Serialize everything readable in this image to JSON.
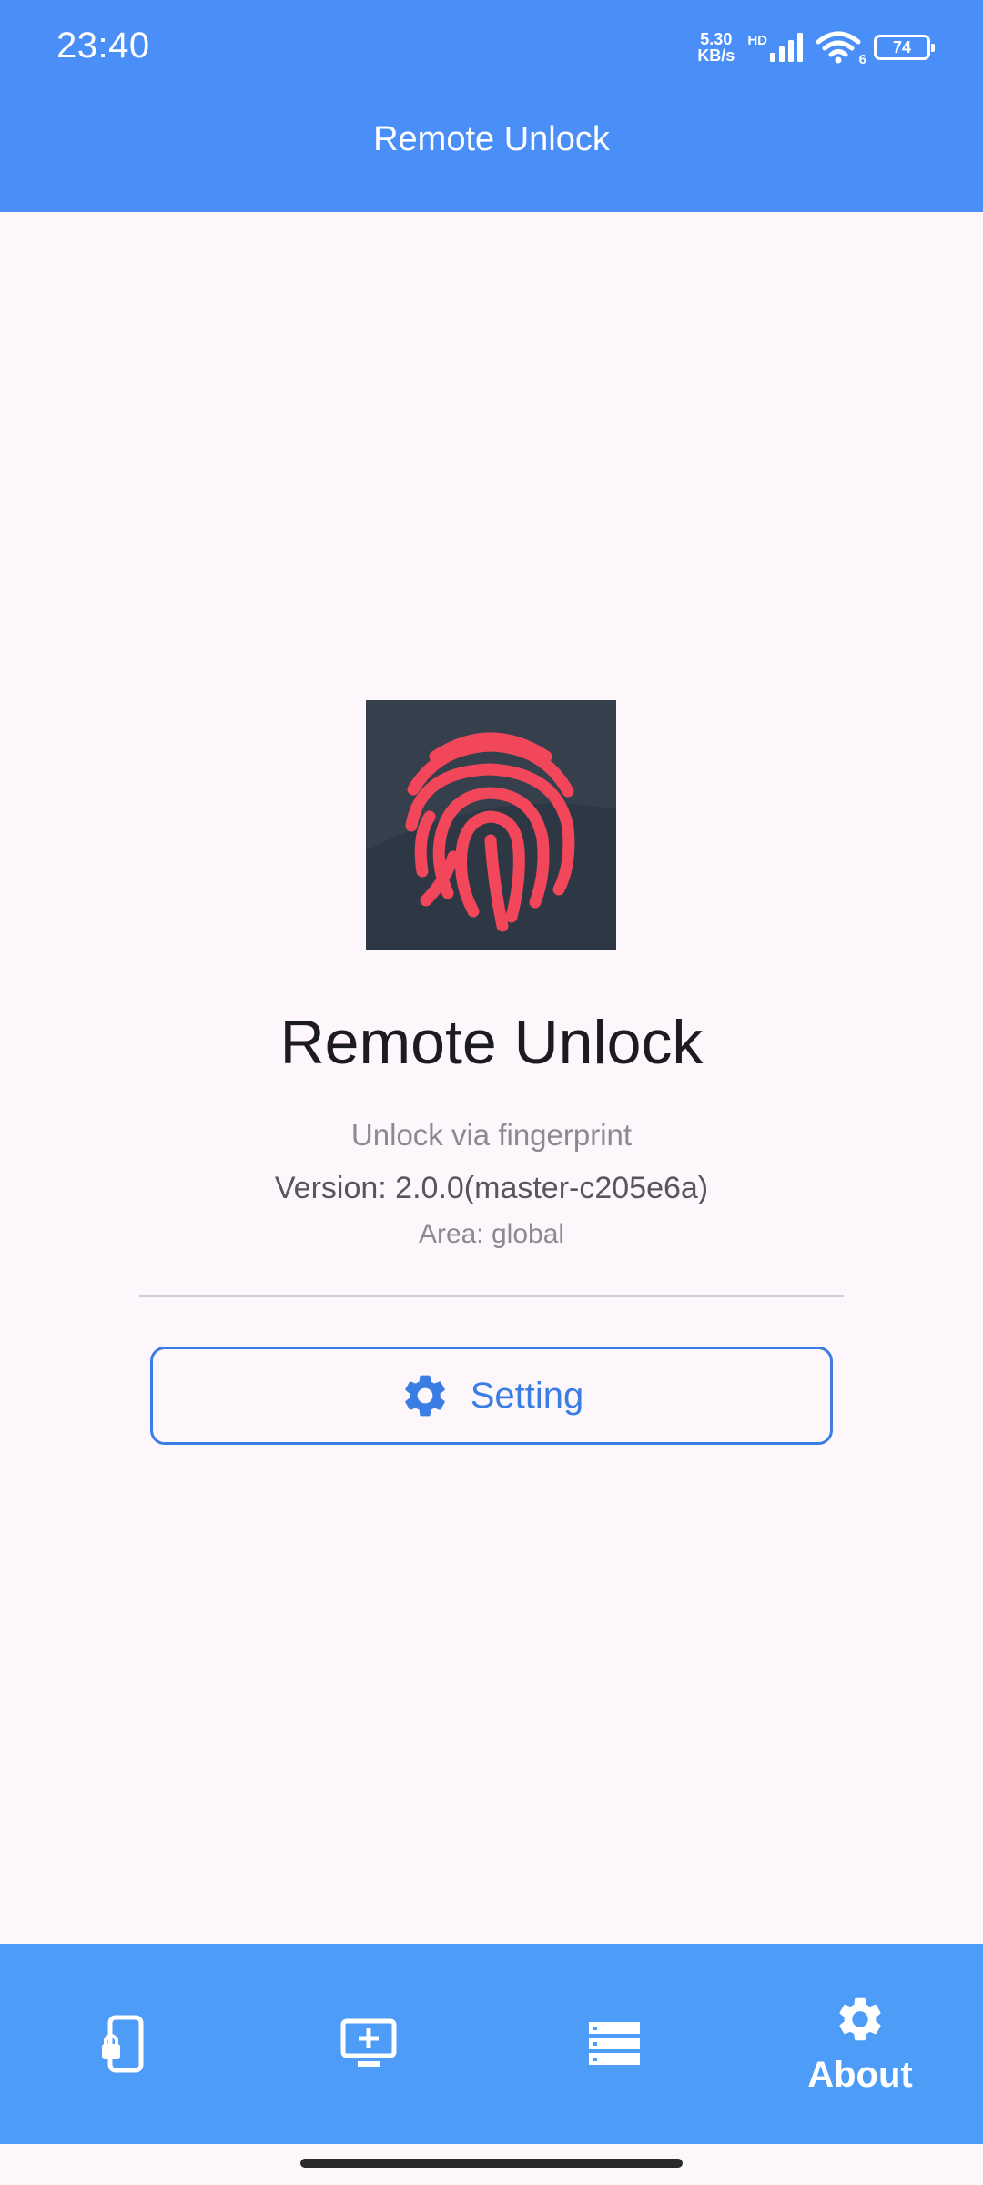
{
  "status_bar": {
    "time": "23:40",
    "net_speed_value": "5.30",
    "net_speed_unit": "KB/s",
    "hd_label": "HD",
    "wifi_label": "6",
    "battery": "74"
  },
  "app_bar": {
    "title": "Remote Unlock"
  },
  "about": {
    "app_name": "Remote Unlock",
    "description": "Unlock via fingerprint",
    "version": "Version: 2.0.0(master-c205e6a)",
    "area": "Area: global",
    "setting_label": "Setting"
  },
  "bottom_nav": {
    "items": [
      {
        "icon": "phone-lock-icon",
        "label": ""
      },
      {
        "icon": "add-to-screen-icon",
        "label": ""
      },
      {
        "icon": "list-icon",
        "label": ""
      },
      {
        "icon": "gear-icon",
        "label": "About",
        "selected": true
      }
    ]
  },
  "colors": {
    "primary": "#4a8ff7",
    "nav_background": "#4d9df8",
    "page_background": "#fdf7fc",
    "button_accent": "#3b7ee3",
    "fingerprint": "#f2475a",
    "icon_background": "#35404c"
  }
}
